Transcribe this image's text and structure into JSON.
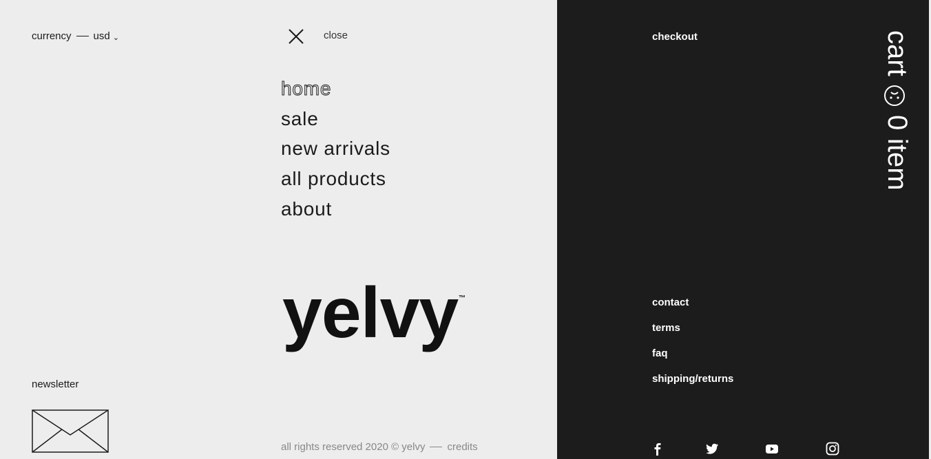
{
  "header": {
    "currency_label": "currency",
    "currency_value": "usd",
    "close_label": "close"
  },
  "menu": {
    "items": [
      {
        "label": "home",
        "active": true
      },
      {
        "label": "sale"
      },
      {
        "label": "new arrivals"
      },
      {
        "label": "all products"
      },
      {
        "label": "about"
      }
    ]
  },
  "brand": {
    "logo": "yelvy",
    "trademark": "™"
  },
  "newsletter": {
    "label": "newsletter",
    "icon": "envelope-icon"
  },
  "footer": {
    "copyright": "all rights reserved 2020 © yelvy",
    "credits": "credits"
  },
  "sidebar": {
    "checkout": "checkout",
    "cart_label": "cart",
    "cart_count": "0",
    "cart_unit": "item",
    "links": [
      "contact",
      "terms",
      "faq",
      "shipping/returns"
    ],
    "social": [
      "facebook-icon",
      "twitter-icon",
      "youtube-icon",
      "instagram-icon"
    ]
  },
  "colors": {
    "background": "#ededed",
    "dark_panel": "#1b1c1b",
    "text": "#1b1b1b",
    "muted": "#888888"
  }
}
